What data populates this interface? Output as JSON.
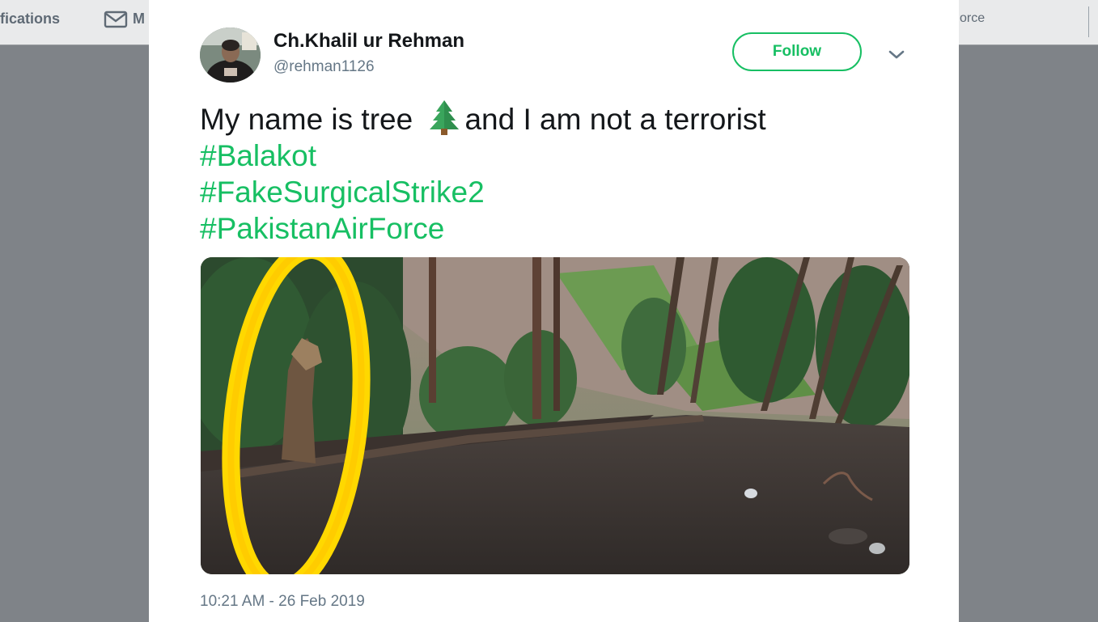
{
  "background_nav": {
    "notifications_label": "fications",
    "messages_label": "M",
    "right_label": "orce"
  },
  "tweet": {
    "display_name": "Ch.Khalil ur Rehman",
    "handle": "@rehman1126",
    "follow_label": "Follow",
    "text_before_emoji": "My name is tree ",
    "text_after_emoji": "and I am not a terrorist",
    "emoji_icon": "evergreen-tree-icon",
    "hashtags": [
      "#Balakot",
      "#FakeSurgicalStrike2",
      "#PakistanAirForce"
    ],
    "timestamp": "10:21 AM - 26 Feb 2019"
  },
  "colors": {
    "accent": "#17bf63",
    "text": "#14171a",
    "secondary": "#657786",
    "overlay": "#7f8388"
  }
}
